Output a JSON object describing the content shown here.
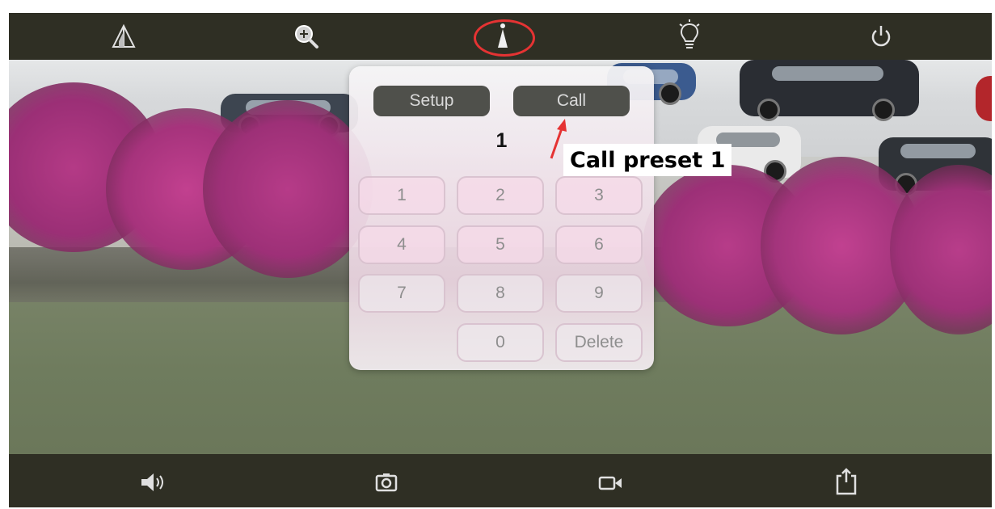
{
  "toolbar_top": {
    "icons": [
      "mirror-triangle-icon",
      "zoom-in-icon",
      "preset-pin-icon",
      "light-bulb-icon",
      "power-icon"
    ]
  },
  "keypad": {
    "setup_label": "Setup",
    "call_label": "Call",
    "display_value": "1",
    "keys": [
      "1",
      "2",
      "3",
      "4",
      "5",
      "6",
      "7",
      "8",
      "9",
      "0",
      "Delete"
    ]
  },
  "annotation": {
    "text": "Call preset 1",
    "color": "#e53333"
  },
  "toolbar_bottom": {
    "icons": [
      "speaker-icon",
      "camera-snapshot-icon",
      "video-record-icon",
      "share-icon"
    ]
  }
}
